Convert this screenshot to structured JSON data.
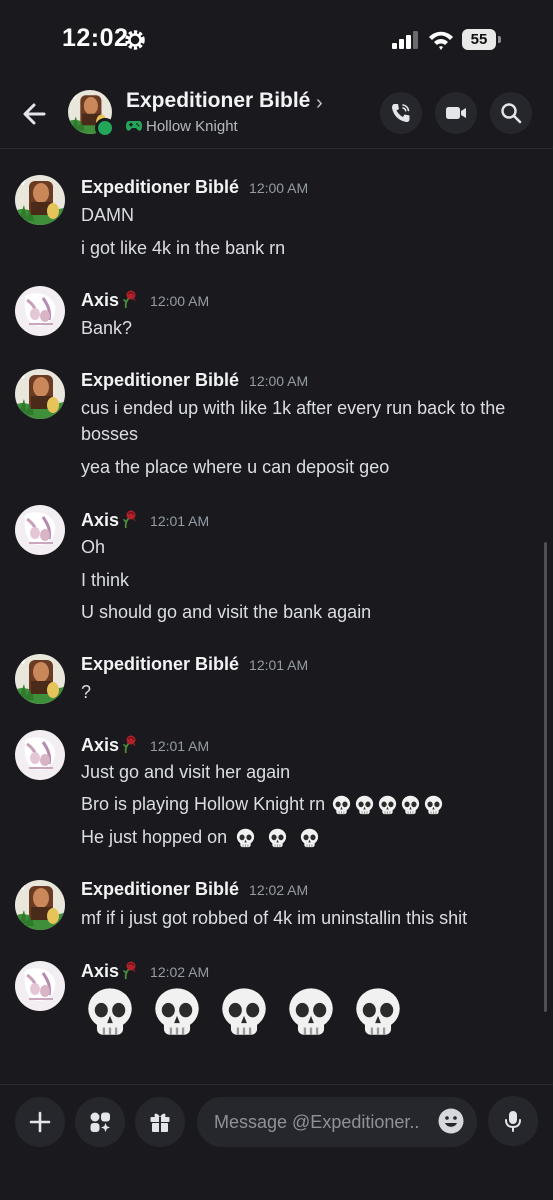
{
  "status_bar": {
    "time": "12:02",
    "battery": "55"
  },
  "header": {
    "name": "Expeditioner Biblé",
    "chevron": "›",
    "activity": "Hollow Knight"
  },
  "icons": {
    "back": "arrow-left-icon",
    "call": "phone-call-icon",
    "video": "video-camera-icon",
    "search": "search-icon",
    "skull": "skull-emoji",
    "rose": "wilted-rose-emoji"
  },
  "colors": {
    "background": "#1a1a1e",
    "surface": "#26272c",
    "online": "#23a55a",
    "timestamp": "#949ba4",
    "text": "#dbdee1"
  },
  "messages": [
    {
      "author": "Expeditioner Biblé",
      "time": "12:00 AM",
      "lines": [
        "DAMN",
        "i got like 4k in the bank rn"
      ]
    },
    {
      "author": "Axis",
      "time": "12:00 AM",
      "lines": [
        "Bank?"
      ]
    },
    {
      "author": "Expeditioner Biblé",
      "time": "12:00 AM",
      "lines": [
        "cus i ended up with like 1k after every run back to the bosses",
        "yea the place where u can deposit geo"
      ]
    },
    {
      "author": "Axis",
      "time": "12:01 AM",
      "lines": [
        "Oh",
        "I think",
        "U should go and visit the bank again"
      ]
    },
    {
      "author": "Expeditioner Biblé",
      "time": "12:01 AM",
      "lines": [
        "?"
      ]
    },
    {
      "author": "Axis",
      "time": "12:01 AM",
      "lines": [
        "Just go and visit her again",
        "Bro is playing Hollow Knight rn",
        "He just hopped on"
      ]
    },
    {
      "author": "Expeditioner Biblé",
      "time": "12:02 AM",
      "lines": [
        "mf if i just got robbed of 4k im uninstallin this shit"
      ]
    },
    {
      "author": "Axis",
      "time": "12:02 AM",
      "lines": []
    }
  ],
  "composer": {
    "placeholder": "Message @Expeditioner.."
  }
}
